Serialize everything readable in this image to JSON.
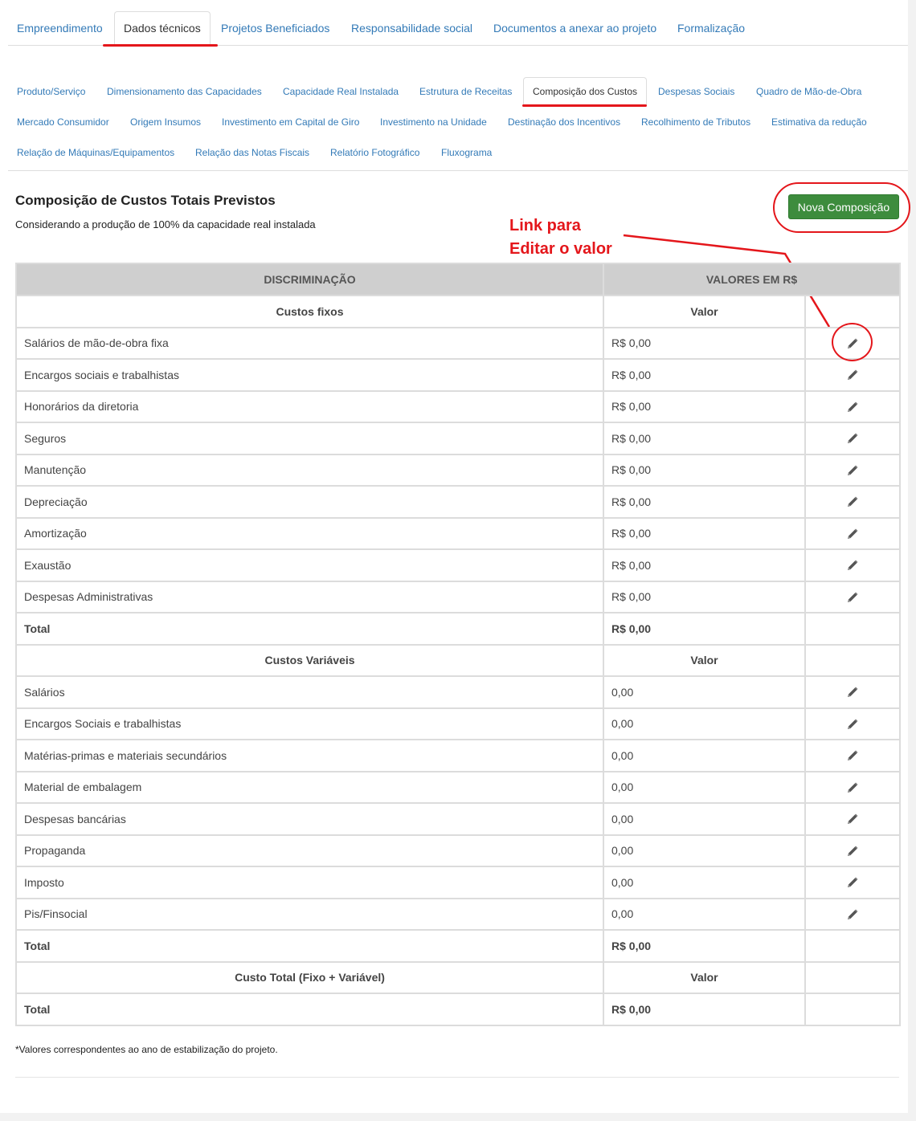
{
  "main_tabs": [
    "Empreendimento",
    "Dados técnicos",
    "Projetos Beneficiados",
    "Responsabilidade social",
    "Documentos a anexar ao projeto",
    "Formalização"
  ],
  "main_tab_active": "Dados técnicos",
  "sub_tabs_row1": [
    "Produto/Serviço",
    "Dimensionamento das Capacidades",
    "Capacidade Real Instalada",
    "Estrutura de Receitas",
    "Composição dos Custos",
    "Despesas Sociais",
    "Quadro de Mão-de-Obra"
  ],
  "sub_tabs_row2": [
    "Mercado Consumidor",
    "Origem Insumos",
    "Investimento em Capital de Giro",
    "Investimento na Unidade",
    "Destinação dos Incentivos",
    "Recolhimento de Tributos",
    "Estimativa da redução"
  ],
  "sub_tabs_row3": [
    "Relação de Máquinas/Equipamentos",
    "Relação das Notas Fiscais",
    "Relatório Fotográfico",
    "Fluxograma"
  ],
  "sub_tab_active": "Composição dos Custos",
  "section": {
    "title": "Composição de Custos Totais Previstos",
    "subtitle": "Considerando a produção de 100% da capacidade real instalada",
    "new_button": "Nova Composição"
  },
  "annotation": {
    "line1": "Link para",
    "line2": "Editar o valor"
  },
  "table": {
    "headers": [
      "DISCRIMINAÇÃO",
      "VALORES EM R$"
    ],
    "fixed": {
      "title": "Custos fixos",
      "value_header": "Valor",
      "rows": [
        {
          "label": "Salários de mão-de-obra fixa",
          "value": "R$ 0,00"
        },
        {
          "label": "Encargos sociais e trabalhistas",
          "value": "R$ 0,00"
        },
        {
          "label": "Honorários da diretoria",
          "value": "R$ 0,00"
        },
        {
          "label": "Seguros",
          "value": "R$ 0,00"
        },
        {
          "label": "Manutenção",
          "value": "R$ 0,00"
        },
        {
          "label": "Depreciação",
          "value": "R$ 0,00"
        },
        {
          "label": "Amortização",
          "value": "R$ 0,00"
        },
        {
          "label": "Exaustão",
          "value": "R$ 0,00"
        },
        {
          "label": "Despesas Administrativas",
          "value": "R$ 0,00"
        }
      ],
      "total_label": "Total",
      "total_value": "R$ 0,00"
    },
    "variable": {
      "title": "Custos Variáveis",
      "value_header": "Valor",
      "rows": [
        {
          "label": "Salários",
          "value": "0,00"
        },
        {
          "label": "Encargos Sociais e trabalhistas",
          "value": "0,00"
        },
        {
          "label": "Matérias-primas e materiais secundários",
          "value": "0,00"
        },
        {
          "label": "Material de embalagem",
          "value": "0,00"
        },
        {
          "label": "Despesas bancárias",
          "value": "0,00"
        },
        {
          "label": "Propaganda",
          "value": "0,00"
        },
        {
          "label": "Imposto",
          "value": "0,00"
        },
        {
          "label": "Pis/Finsocial",
          "value": "0,00"
        }
      ],
      "total_label": "Total",
      "total_value": "R$ 0,00"
    },
    "grand": {
      "title": "Custo Total (Fixo + Variável)",
      "value_header": "Valor",
      "total_label": "Total",
      "total_value": "R$ 0,00"
    }
  },
  "footnote": "*Valores correspondentes ao ano de estabilização do projeto.",
  "colors": {
    "link": "#337ab7",
    "button": "#3d8c3d",
    "annotation": "#e4161b",
    "table_header": "#cfcfcf"
  },
  "icons": {
    "edit": "pencil-icon"
  }
}
